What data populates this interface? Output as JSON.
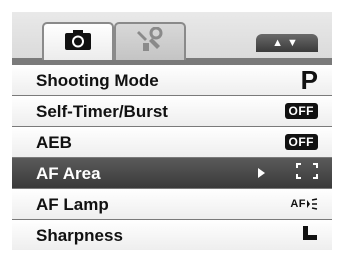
{
  "tabs": [
    {
      "name": "camera",
      "icon": "camera-icon",
      "active": true
    },
    {
      "name": "setup",
      "icon": "wrench-icon",
      "active": false
    }
  ],
  "scroll_indicator": {
    "text": "▲▼"
  },
  "menu": {
    "items": [
      {
        "label": "Shooting Mode",
        "value": "P",
        "value_type": "mode-icon"
      },
      {
        "label": "Self-Timer/Burst",
        "value": "OFF",
        "value_type": "off-badge"
      },
      {
        "label": "AEB",
        "value": "OFF",
        "value_type": "off-badge"
      },
      {
        "label": "AF Area",
        "value_type": "af-area-bracket-icon",
        "selected": true
      },
      {
        "label": "AF Lamp",
        "value": "AF",
        "value_type": "af-lamp-icon"
      },
      {
        "label": "Sharpness",
        "value_type": "sharpness-icon"
      }
    ]
  },
  "colors": {
    "row_background": "#ffffff",
    "selected_row": "#4a4a4a",
    "panel_border": "#7a7a7a",
    "text": "#111111"
  }
}
